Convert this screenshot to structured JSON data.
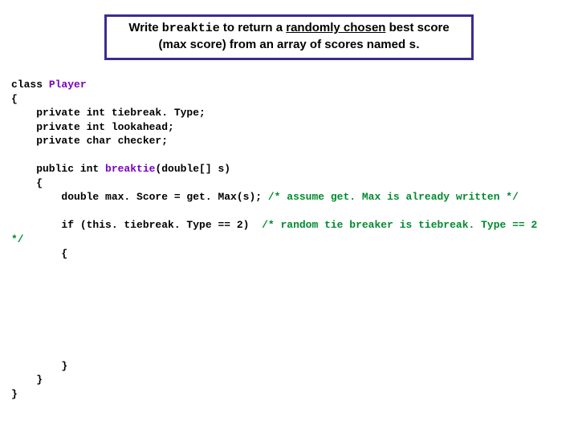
{
  "banner": {
    "w1": "Write ",
    "mono": "breaktie",
    "w2": " to return a ",
    "ul": "randomly chosen",
    "w3": " best score",
    "line2a": "(max score) from an array of scores named ",
    "line2mono": "s",
    "line2b": "."
  },
  "code": {
    "l1a": "class ",
    "l1b": "Player",
    "l2": "{",
    "l3": "    private int tiebreak. Type;",
    "l4": "    private int lookahead;",
    "l5": "    private char checker;",
    "blank1": "",
    "l6a": "    public int ",
    "l6b": "breaktie",
    "l6c": "(double[] s)",
    "l7": "    {",
    "l8a": "        double max. Score = get. Max(s); ",
    "l8b": "/* assume get. Max is already written */",
    "blank2": "",
    "l9a": "        if (this. tiebreak. Type == 2)  ",
    "l9b": "/* random tie breaker is tiebreak. Type == 2",
    "l10": "*/",
    "l11": "        {",
    "blank3": "",
    "blank4": "",
    "blank5": "",
    "blank6": "",
    "blank7": "",
    "blank8": "",
    "blank9": "",
    "l12": "        }",
    "l13": "    }",
    "l14": "}"
  }
}
